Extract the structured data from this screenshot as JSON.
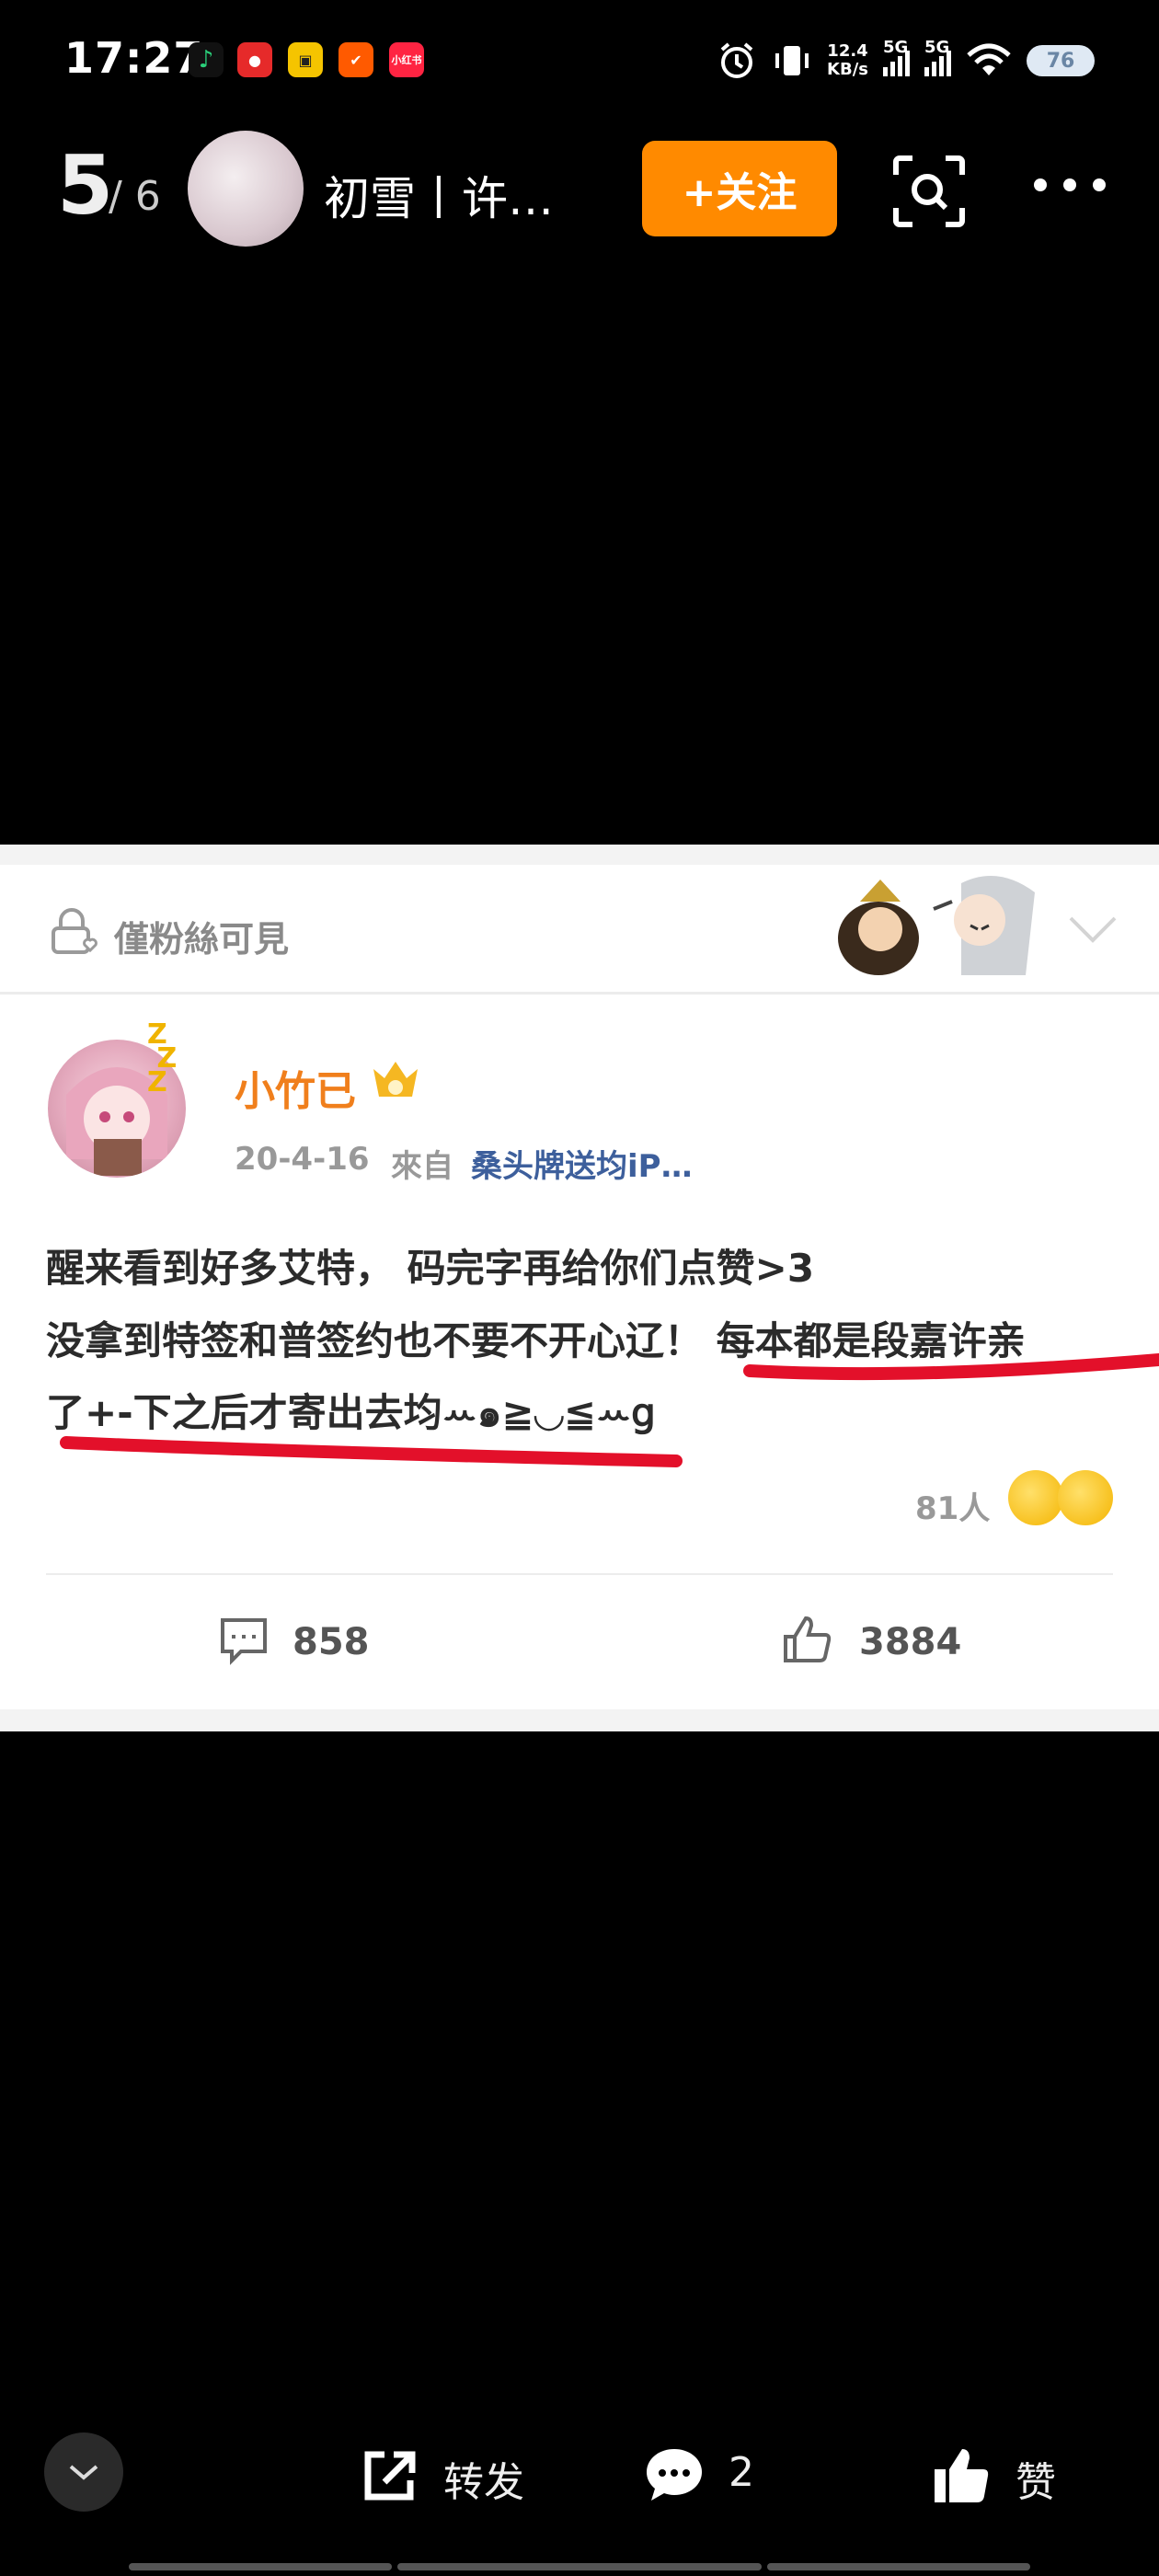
{
  "status_bar": {
    "time": "17:27",
    "net_speed_value": "12.4",
    "net_speed_unit": "KB/s",
    "signal1": "5G",
    "signal2": "5G",
    "battery": "76",
    "app_icons": [
      {
        "name": "music-app-icon",
        "color": "#111",
        "glyph": "♪"
      },
      {
        "name": "social-app-icon",
        "color": "#e62a2a",
        "glyph": "●"
      },
      {
        "name": "yellow-app-icon",
        "color": "#f5c400",
        "glyph": "▣"
      },
      {
        "name": "taobao-app-icon",
        "color": "#ff5a00",
        "glyph": "✔"
      },
      {
        "name": "xiaohongshu-app-icon",
        "color": "#ff2442",
        "glyph": "小红书"
      }
    ]
  },
  "nav": {
    "page_current": "5",
    "page_total": "/ 6",
    "account_name": "初雪丨许…",
    "follow_label": "+关注"
  },
  "post": {
    "fans_only": "僅粉絲可見",
    "username": "小竹已",
    "date": "20-4-16",
    "from_label": "來自",
    "source": "桑头牌送均iP…",
    "lines": [
      "醒来看到好多艾特， 码完字再给你们点赞>3",
      "没拿到特签和普签约也不要不开心辽！ 每本都是段嘉许亲",
      "了+-下之后才寄出去均ꕀ๑≧◡≦ꕀ𝗀"
    ],
    "reaction_count": "81人",
    "comments": "858",
    "likes": "3884"
  },
  "bottom_bar": {
    "share_label": "转发",
    "comment_count": "2",
    "like_label": "赞"
  },
  "colors": {
    "accent": "#ff8a00",
    "highlight_underline": "#e3102a",
    "source_link": "#3d5f9c",
    "username": "#f07f1c"
  }
}
